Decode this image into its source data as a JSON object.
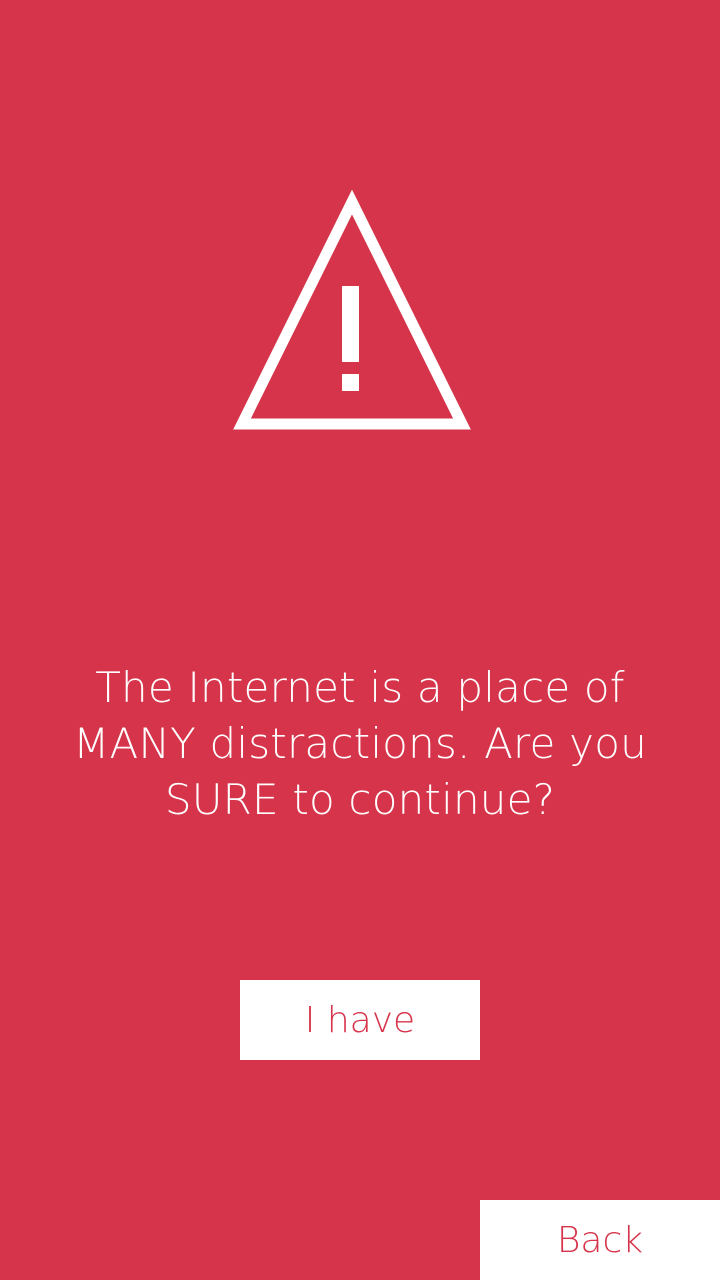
{
  "colors": {
    "background": "#d6344a",
    "foreground": "#ffffff",
    "button_text": "#d6344a"
  },
  "warning": {
    "icon": "warning-triangle-icon",
    "message": "The Internet is a place of MANY distractions. Are you SURE to continue?"
  },
  "buttons": {
    "confirm_label": "I have",
    "back_label": "Back"
  }
}
